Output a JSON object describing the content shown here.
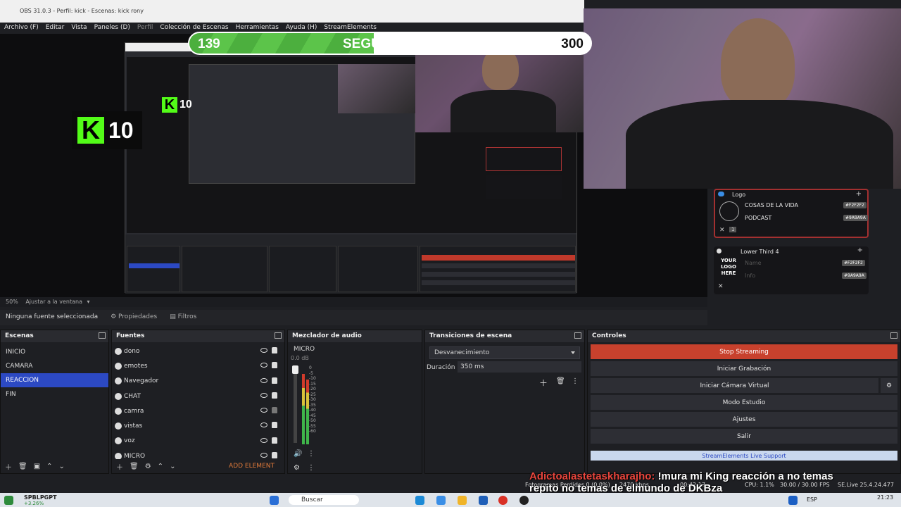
{
  "window": {
    "title": "OBS 31.0.3 - Perfil: kick - Escenas: kick rony"
  },
  "menu": [
    "Archivo (F)",
    "Editar",
    "Vista",
    "Paneles (D)",
    "Perfil",
    "Colección de Escenas",
    "Herramientas",
    "Ayuda (H)",
    "StreamElements"
  ],
  "followers": {
    "current": "139",
    "label": "SEGUIDORES",
    "goal": "300",
    "progress": 0.46
  },
  "kick_badge": {
    "count": "10",
    "letter": "K"
  },
  "preview": {
    "zoom": "50%",
    "fit_label": "Ajustar a la ventana"
  },
  "properties": {
    "no_source": "Ninguna fuente seleccionada",
    "props_tab": "Propiedades",
    "filters_tab": "Filtros"
  },
  "scenes": {
    "title": "Escenas",
    "items": [
      "INICIO",
      "CAMARA",
      "REACCION",
      "FIN"
    ],
    "selected": 2
  },
  "sources": {
    "title": "Fuentes",
    "items": [
      "dono",
      "emotes",
      "Navegador",
      "CHAT",
      "camra",
      "vistas",
      "voz",
      "MICRO"
    ],
    "add_element": "ADD ELEMENT"
  },
  "mixer": {
    "title": "Mezclador de audio",
    "channel": "MICRO",
    "level": "0.0 dB",
    "ticks": [
      "0",
      "-5",
      "-10",
      "-15",
      "-20",
      "-25",
      "-30",
      "-35",
      "-40",
      "-45",
      "-50",
      "-55",
      "-60"
    ]
  },
  "transitions": {
    "title": "Transiciones de escena",
    "selected": "Desvanecimiento",
    "duration_label": "Duración",
    "duration_value": "350 ms"
  },
  "controls": {
    "title": "Controles",
    "stop": "Stop Streaming",
    "record": "Iniciar Grabación",
    "virtual_cam": "Iniciar Cámara Virtual",
    "studio": "Modo Estudio",
    "settings": "Ajustes",
    "exit": "Salir",
    "se_support": "StreamElements Live Support"
  },
  "lower_thirds": {
    "panel1": {
      "title": "Logo",
      "line1": "COSAS DE LA VIDA",
      "line2": "PODCAST",
      "color1": "#F2F2F2",
      "color2": "#9A9A9A",
      "page": "1"
    },
    "panel2": {
      "title": "Lower Third 4",
      "logo_text": "YOUR LOGO HERE",
      "field1": "Name",
      "field2": "Info",
      "color1": "#F2F2F2",
      "color2": "#9A9A9A"
    }
  },
  "status": {
    "dropped": "Fotogramas Perdidos 0 (0.0%)",
    "bitrate": "2470 kbps",
    "time": "00:42:17",
    "cpu": "CPU: 1.1%",
    "fps": "30.00 / 30.00 FPS",
    "se": "SE.Live 25.4.24.477"
  },
  "chat": {
    "user": "Adictoalastetaskharajho:",
    "message": "!mura mi King reacción a no temas",
    "line2": "repito no temas de elmundo de DKBza"
  },
  "taskbar": {
    "app": "SPBLPGPT",
    "app_sub": "+3.26%",
    "search": "Buscar",
    "lang": "ESP",
    "clock": "21:23"
  }
}
